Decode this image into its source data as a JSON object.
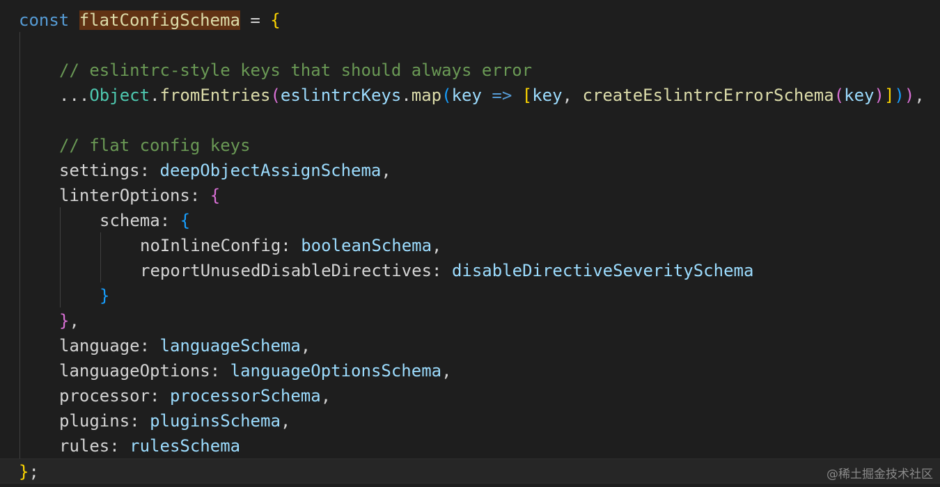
{
  "code": {
    "l1": {
      "kw": "const",
      "name": "flatConfigSchema",
      "eq": " = ",
      "brace": "{"
    },
    "l3": {
      "comment": "// eslintrc-style keys that should always error"
    },
    "l4": {
      "spread": "...",
      "obj": "Object",
      "dot1": ".",
      "from": "fromEntries",
      "p1": "(",
      "keys": "eslintrcKeys",
      "dot2": ".",
      "map": "map",
      "p2": "(",
      "param": "key",
      "arrow": " => ",
      "b1": "[",
      "k1": "key",
      "comma1": ", ",
      "create": "createEslintrcErrorSchema",
      "p3": "(",
      "k2": "key",
      "p3c": ")",
      "b1c": "]",
      "p2c": ")",
      "p1c": ")",
      "tail": ","
    },
    "l6": {
      "comment": "// flat config keys"
    },
    "l7": {
      "prop": "settings",
      "colon": ": ",
      "val": "deepObjectAssignSchema",
      "tail": ","
    },
    "l8": {
      "prop": "linterOptions",
      "colon": ": ",
      "brace": "{"
    },
    "l9": {
      "prop": "schema",
      "colon": ": ",
      "brace": "{"
    },
    "l10": {
      "prop": "noInlineConfig",
      "colon": ": ",
      "val": "booleanSchema",
      "tail": ","
    },
    "l11": {
      "prop": "reportUnusedDisableDirectives",
      "colon": ": ",
      "val": "disableDirectiveSeveritySchema"
    },
    "l12": {
      "brace": "}"
    },
    "l13": {
      "brace": "}",
      "tail": ","
    },
    "l14": {
      "prop": "language",
      "colon": ": ",
      "val": "languageSchema",
      "tail": ","
    },
    "l15": {
      "prop": "languageOptions",
      "colon": ": ",
      "val": "languageOptionsSchema",
      "tail": ","
    },
    "l16": {
      "prop": "processor",
      "colon": ": ",
      "val": "processorSchema",
      "tail": ","
    },
    "l17": {
      "prop": "plugins",
      "colon": ": ",
      "val": "pluginsSchema",
      "tail": ","
    },
    "l18": {
      "prop": "rules",
      "colon": ": ",
      "val": "rulesSchema"
    },
    "l19": {
      "brace": "}",
      "semi": ";"
    }
  },
  "watermark": "@稀土掘金技术社区",
  "colors": {
    "background": "#1e1e1e",
    "keyword": "#569cd6",
    "comment": "#6a9955",
    "function": "#dcdcaa",
    "variable": "#9cdcfe",
    "type": "#4ec9b0",
    "bracket_gold": "#ffd700",
    "bracket_orchid": "#da70d6",
    "bracket_blue": "#179fff",
    "selection_highlight": "#613214"
  }
}
